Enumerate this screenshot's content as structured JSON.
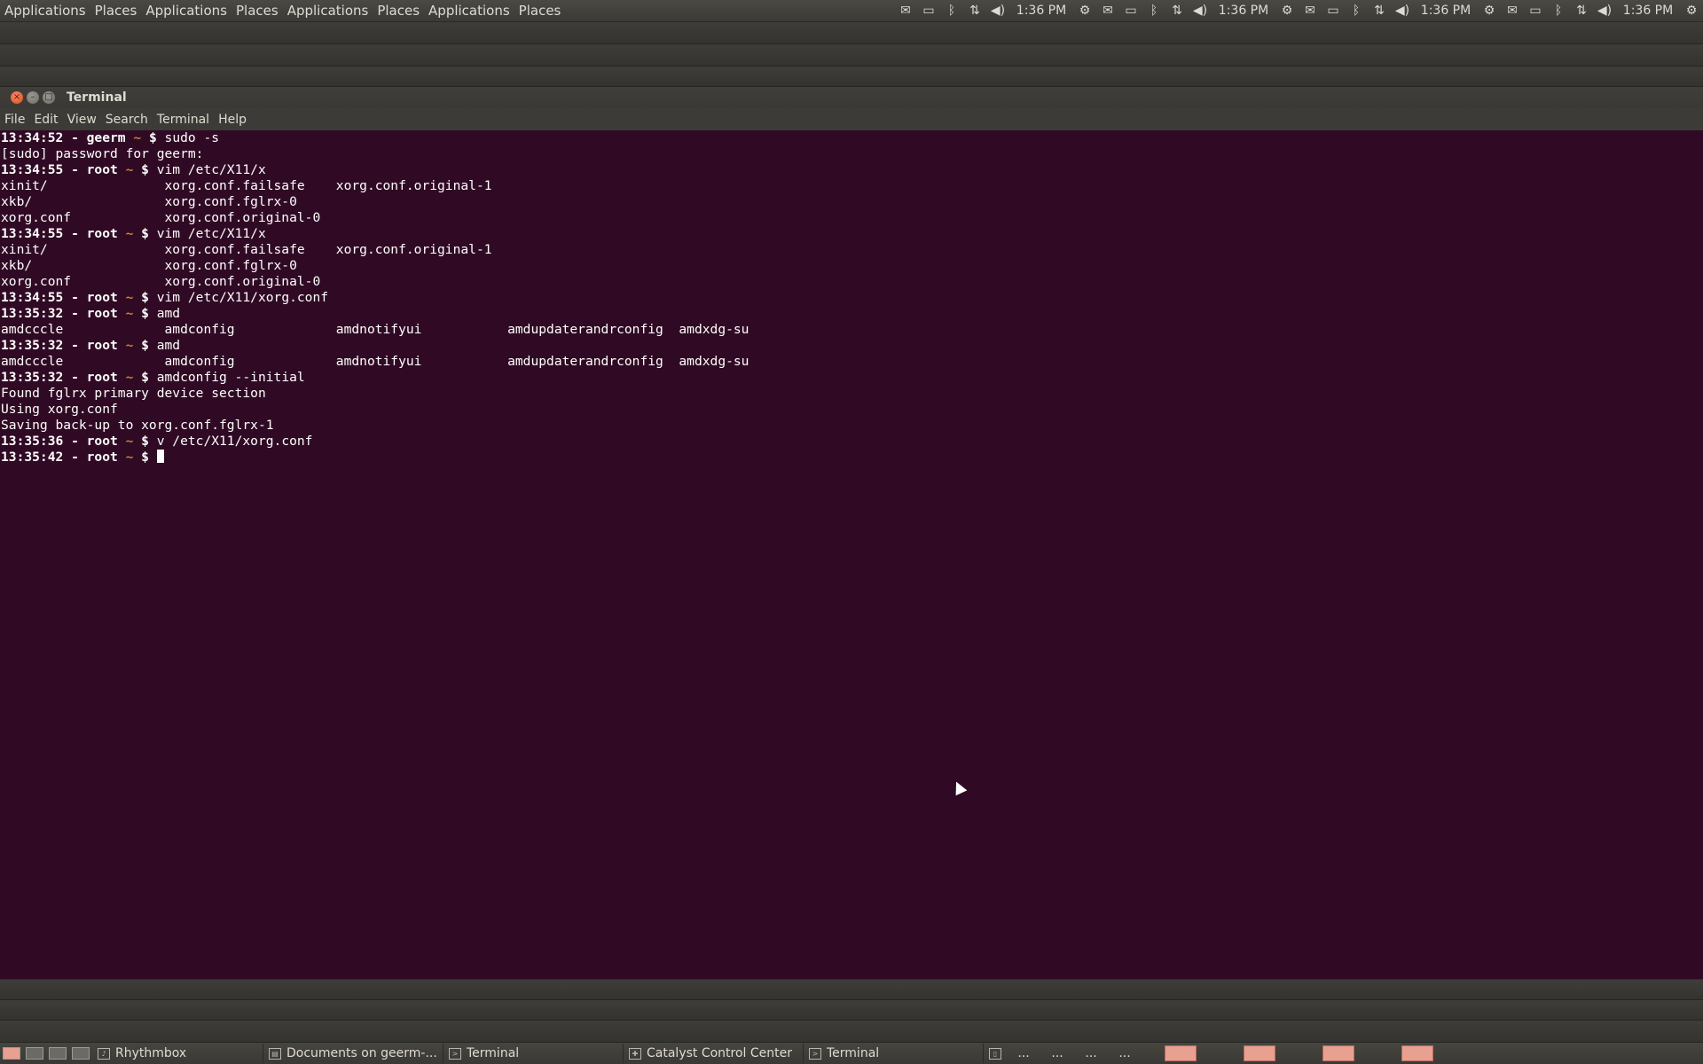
{
  "top_panel": {
    "menus": [
      "Applications",
      "Places",
      "Applications",
      "Places",
      "Applications",
      "Places",
      "Applications",
      "Places"
    ],
    "tray_groups": [
      {
        "time": "1:36 PM"
      },
      {
        "time": "1:36 PM"
      },
      {
        "time": "1:36 PM"
      },
      {
        "time": "1:36 PM"
      }
    ]
  },
  "window": {
    "title": "Terminal",
    "menu": [
      "File",
      "Edit",
      "View",
      "Search",
      "Terminal",
      "Help"
    ]
  },
  "terminal": {
    "lines": [
      {
        "prompt": "13:34:52 - geerm",
        "cmd": "sudo -s"
      },
      {
        "text": "[sudo] password for geerm:"
      },
      {
        "prompt": "13:34:55 - root",
        "cmd": "vim /etc/X11/x"
      },
      {
        "text": "xinit/               xorg.conf.failsafe    xorg.conf.original-1"
      },
      {
        "text": "xkb/                 xorg.conf.fglrx-0"
      },
      {
        "text": "xorg.conf            xorg.conf.original-0"
      },
      {
        "prompt": "13:34:55 - root",
        "cmd": "vim /etc/X11/x"
      },
      {
        "text": "xinit/               xorg.conf.failsafe    xorg.conf.original-1"
      },
      {
        "text": "xkb/                 xorg.conf.fglrx-0"
      },
      {
        "text": "xorg.conf            xorg.conf.original-0"
      },
      {
        "prompt": "13:34:55 - root",
        "cmd": "vim /etc/X11/xorg.conf"
      },
      {
        "prompt": "13:35:32 - root",
        "cmd": "amd"
      },
      {
        "text": "amdcccle             amdconfig             amdnotifyui           amdupdaterandrconfig  amdxdg-su"
      },
      {
        "prompt": "13:35:32 - root",
        "cmd": "amd"
      },
      {
        "text": "amdcccle             amdconfig             amdnotifyui           amdupdaterandrconfig  amdxdg-su"
      },
      {
        "prompt": "13:35:32 - root",
        "cmd": "amdconfig --initial"
      },
      {
        "text": "Found fglrx primary device section"
      },
      {
        "text": "Using xorg.conf"
      },
      {
        "text": "Saving back-up to xorg.conf.fglrx-1"
      },
      {
        "prompt": "13:35:36 - root",
        "cmd": "v /etc/X11/xorg.conf"
      },
      {
        "prompt": "13:35:42 - root",
        "cmd": ""
      }
    ]
  },
  "taskbar": {
    "tasks": [
      {
        "label": "Rhythmbox"
      },
      {
        "label": "Documents on geerm-..."
      },
      {
        "label": "Terminal"
      },
      {
        "label": "Catalyst Control Center"
      },
      {
        "label": "Terminal"
      }
    ],
    "ellipses": [
      "...",
      "...",
      "...",
      "..."
    ]
  }
}
